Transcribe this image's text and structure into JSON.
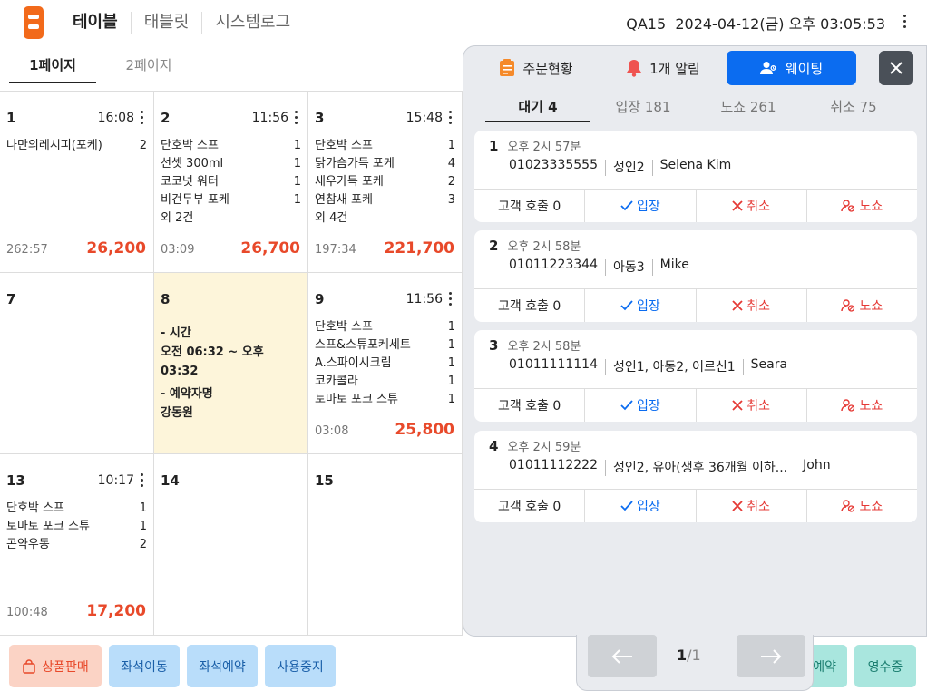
{
  "header": {
    "tabs": [
      "테이블",
      "태블릿",
      "시스템로그"
    ],
    "status": "QA15  2024-04-12(금) 오후 03:05:53"
  },
  "page_tabs": [
    "1페이지",
    "2페이지"
  ],
  "tables": [
    {
      "no": "1",
      "time": "16:08",
      "items": [
        {
          "n": "나만의레시피(포케)",
          "q": "2"
        }
      ],
      "extra": "",
      "elapsed": "262:57",
      "price": "26,200"
    },
    {
      "no": "2",
      "time": "11:56",
      "items": [
        {
          "n": "단호박 스프",
          "q": "1"
        },
        {
          "n": "선셋 300ml",
          "q": "1"
        },
        {
          "n": "코코넛 워터",
          "q": "1"
        },
        {
          "n": "비건두부 포케",
          "q": "1"
        }
      ],
      "extra": "외 2건",
      "elapsed": "03:09",
      "price": "26,700"
    },
    {
      "no": "3",
      "time": "15:48",
      "items": [
        {
          "n": "단호박 스프",
          "q": "1"
        },
        {
          "n": "닭가슴가득 포케",
          "q": "4"
        },
        {
          "n": "새우가득 포케",
          "q": "2"
        },
        {
          "n": "연참새 포케",
          "q": "3"
        }
      ],
      "extra": "외 4건",
      "elapsed": "197:34",
      "price": "221,700"
    },
    {
      "no": "7"
    },
    {
      "no": "8",
      "reservation": {
        "time_label": "- 시간",
        "time": "오전 06:32 ~ 오후 03:32",
        "name_label": "- 예약자명",
        "name": "강동원"
      }
    },
    {
      "no": "9",
      "time": "11:56",
      "items": [
        {
          "n": "단호박 스프",
          "q": "1"
        },
        {
          "n": "스프&스튜포케세트",
          "q": "1"
        },
        {
          "n": "A.스파이시크림",
          "q": "1"
        },
        {
          "n": "코카콜라",
          "q": "1"
        },
        {
          "n": "토마토 포크 스튜",
          "q": "1"
        }
      ],
      "extra": "",
      "elapsed": "03:08",
      "price": "25,800"
    },
    {
      "no": "13",
      "time": "10:17",
      "items": [
        {
          "n": "단호박 스프",
          "q": "1"
        },
        {
          "n": "토마토 포크 스튜",
          "q": "1"
        },
        {
          "n": "곤약우동",
          "q": "2"
        }
      ],
      "extra": "",
      "elapsed": "100:48",
      "price": "17,200"
    },
    {
      "no": "14"
    },
    {
      "no": "15"
    }
  ],
  "panel": {
    "tabs": {
      "order": "주문현황",
      "alarm": "1개 알림",
      "waiting": "웨이팅"
    },
    "subtabs": [
      "대기 4",
      "입장 181",
      "노쇼 261",
      "취소 75"
    ],
    "waitings": [
      {
        "no": "1",
        "time": "오후 2시 57분",
        "phone": "01023335555",
        "people": "성인2",
        "name": "Selena Kim"
      },
      {
        "no": "2",
        "time": "오후 2시 58분",
        "phone": "01011223344",
        "people": "아동3",
        "name": "Mike"
      },
      {
        "no": "3",
        "time": "오후 2시 58분",
        "phone": "01011111114",
        "people": "성인1, 아동2, 어르신1",
        "name": "Seara"
      },
      {
        "no": "4",
        "time": "오후 2시 59분",
        "phone": "01011112222",
        "people": "성인2, 유아(생후 36개월 이하...",
        "name": "John"
      }
    ],
    "card_actions": {
      "call": "고객 호출 0",
      "enter": "입장",
      "cancel": "취소",
      "noshow": "노쇼"
    }
  },
  "pager": {
    "current": "1",
    "total": "/1"
  },
  "bottom_buttons": {
    "sell": "상품판매",
    "move": "좌석이동",
    "reserve": "좌석예약",
    "stop": "사용중지",
    "reserve2": "예약",
    "receipt": "영수증"
  }
}
